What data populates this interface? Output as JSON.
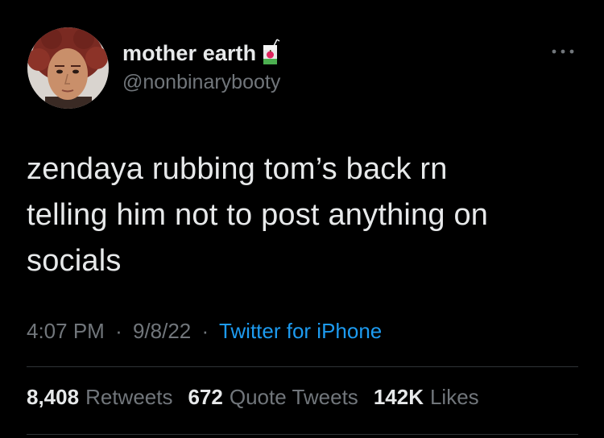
{
  "author": {
    "display_name": "mother earth",
    "handle": "@nonbinarybooty",
    "badge_icon": "juice-box-icon"
  },
  "tweet": {
    "text_lines": [
      "zendaya rubbing tom’s back rn",
      "telling him not to post anything on",
      "socials"
    ],
    "time": "4:07 PM",
    "date": "9/8/22",
    "separator": "·",
    "source": "Twitter for iPhone"
  },
  "stats": {
    "retweets_count": "8,408",
    "retweets_label": "Retweets",
    "quotes_count": "672",
    "quotes_label": "Quote Tweets",
    "likes_count": "142K",
    "likes_label": "Likes"
  },
  "colors": {
    "background": "#000000",
    "primary_text": "#e7e9ea",
    "secondary_text": "#71767b",
    "link": "#1d9bf0",
    "divider": "#2f3336"
  }
}
